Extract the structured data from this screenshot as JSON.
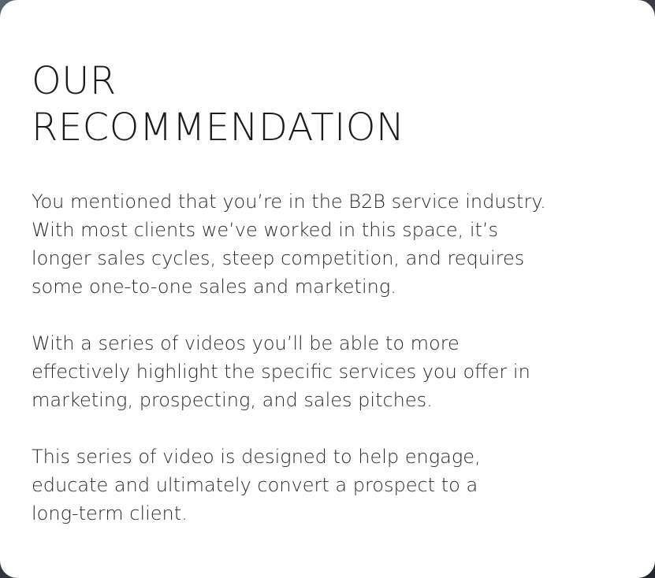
{
  "card": {
    "title_lines": [
      "OUR",
      "RECOMMENDATION"
    ],
    "paragraphs": [
      {
        "lines": [
          "You mentioned that you’re in the B2B service industry.",
          "With most clients we’ve worked in this space, it’s",
          "longer sales cycles, steep competition, and requires",
          "some one-to-one sales and marketing."
        ]
      },
      {
        "lines": [
          "With a series of videos you’ll be able to more",
          "effectively highlight the specific services you offer in",
          "marketing, prospecting, and sales pitches."
        ]
      },
      {
        "lines": [
          "This series of video is designed to help engage,",
          "educate and ultimately convert a prospect to a",
          "long-term client."
        ]
      }
    ]
  },
  "colors": {
    "card_background": "#ffffff",
    "text": "#1f1f1f",
    "backdrop": "#3a3f47"
  }
}
